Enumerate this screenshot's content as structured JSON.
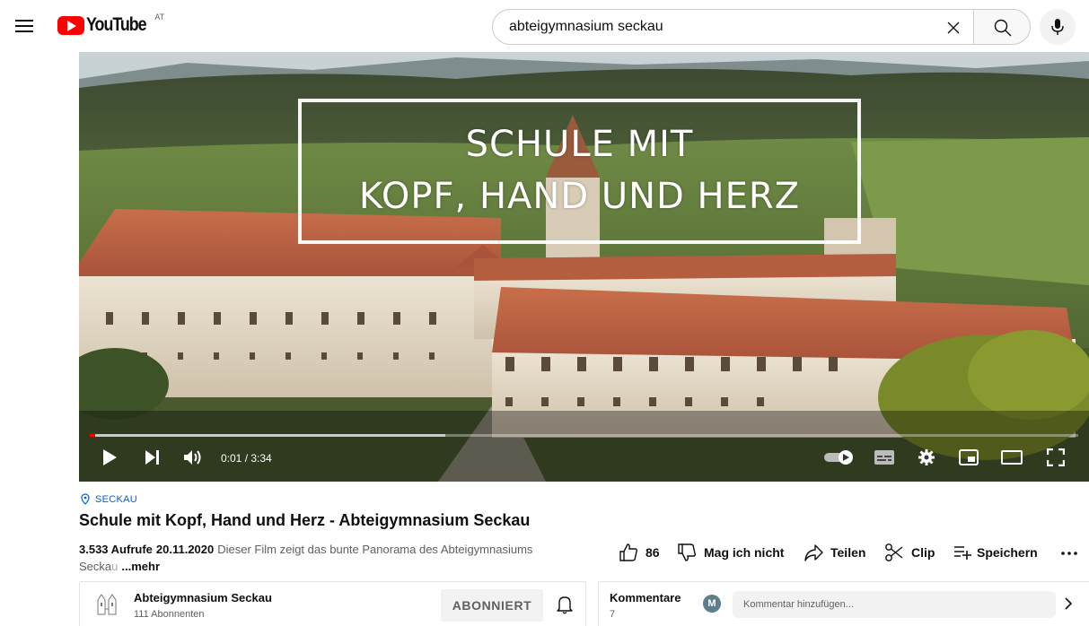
{
  "header": {
    "logo_text": "YouTube",
    "country_code": "AT",
    "search_value": "abteigymnasium seckau"
  },
  "player": {
    "overlay_line1": "SCHULE MIT",
    "overlay_line2": "KOPF, HAND UND HERZ",
    "time_current": "0:01",
    "time_total": "3:34",
    "time_display": "0:01 / 3:34",
    "played_fraction": 0.005,
    "buffered_fraction": 0.36,
    "autoplay_on": true
  },
  "video": {
    "location": "SECKAU",
    "title": "Schule mit Kopf, Hand und Herz - Abteigymnasium Seckau",
    "views": "3.533 Aufrufe",
    "date": "20.11.2020",
    "description_line1": "Dieser Film zeigt das bunte Panorama des Abteigymnasiums",
    "description_line2_visible": "Secka",
    "description_line2_faded": "u",
    "more_label": "...mehr"
  },
  "actions": {
    "like_count": "86",
    "dislike_label": "Mag ich nicht",
    "share_label": "Teilen",
    "clip_label": "Clip",
    "save_label": "Speichern",
    "more_icon": "three-dots-icon"
  },
  "channel": {
    "name": "Abteigymnasium Seckau",
    "subscribers": "111 Abonnenten",
    "subscribe_label": "ABONNIERT"
  },
  "comments": {
    "label": "Kommentare",
    "count": "7",
    "avatar_letter": "M",
    "placeholder": "Kommentar hinzufügen..."
  },
  "colors": {
    "brand_red": "#ff0000",
    "link_blue": "#065fd4",
    "text_primary": "#0f0f0f",
    "text_secondary": "#606060"
  }
}
